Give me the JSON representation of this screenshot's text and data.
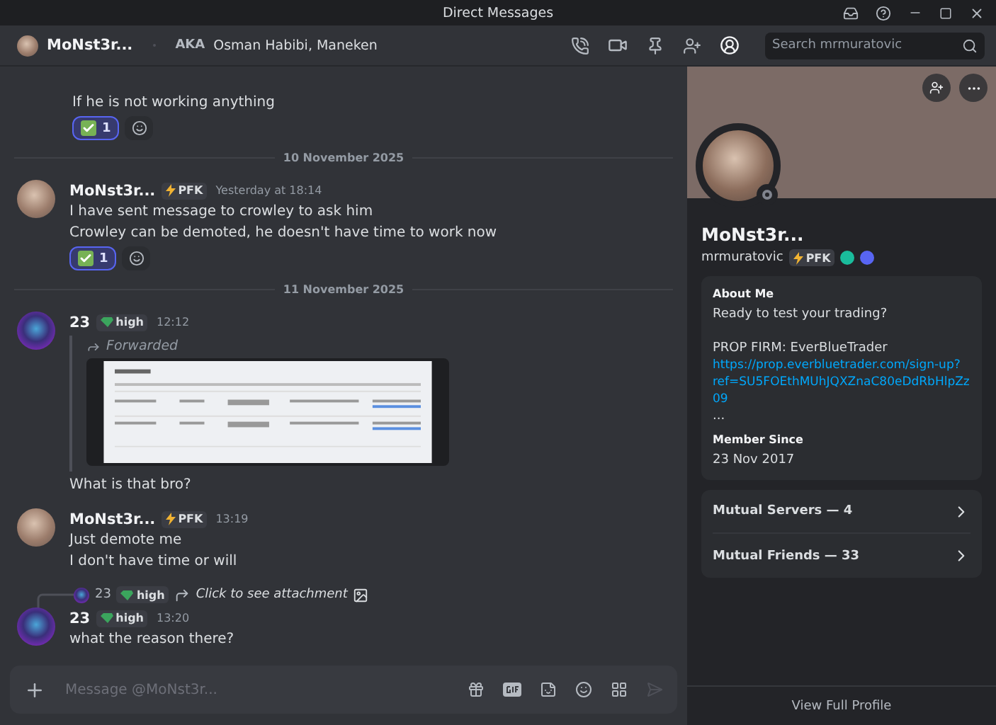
{
  "window": {
    "title": "Direct Messages"
  },
  "header": {
    "name": "MoNst3r...",
    "aka_label": "AKA",
    "aka_names": "Osman Habibi, Maneken",
    "search": {
      "placeholder": "Search mrmuratovic"
    }
  },
  "feed": [
    {
      "kind": "tail",
      "lines": [
        "If he is not working anything"
      ],
      "reactions": [
        {
          "count": "1",
          "selected": true
        }
      ]
    },
    {
      "kind": "divider",
      "label": "10 November 2025"
    },
    {
      "kind": "message",
      "author": "MoNst3r...",
      "tag": {
        "kind": "bolt",
        "label": "PFK"
      },
      "time": "Yesterday at 18:14",
      "lines": [
        "I have sent message to crowley to ask him",
        "Crowley can be demoted, he doesn't have time to work now"
      ],
      "reactions": [
        {
          "count": "1",
          "selected": true
        }
      ]
    },
    {
      "kind": "divider",
      "label": "11 November 2025"
    },
    {
      "kind": "message",
      "author": "23",
      "tag": {
        "kind": "gem",
        "label": "high"
      },
      "time": "12:12",
      "forward": {
        "label": "Forwarded"
      },
      "lines": [
        "What is that bro?"
      ]
    },
    {
      "kind": "message",
      "author": "MoNst3r...",
      "tag": {
        "kind": "bolt",
        "label": "PFK"
      },
      "time": "13:19",
      "lines": [
        "Just demote me",
        "I don't have time or will"
      ]
    },
    {
      "kind": "message",
      "author": "23",
      "tag": {
        "kind": "gem",
        "label": "high"
      },
      "time": "13:20",
      "reply": {
        "author": "23",
        "tag": {
          "kind": "gem",
          "label": "high"
        },
        "text": "Click to see attachment"
      },
      "lines": [
        "what the reason there?"
      ]
    }
  ],
  "composer": {
    "placeholder": "Message @MoNst3r..."
  },
  "profile": {
    "name": "MoNst3r...",
    "username": "mrmuratovic",
    "tag": {
      "kind": "bolt",
      "label": "PFK"
    },
    "about": {
      "title": "About Me",
      "lines": [
        "Ready to test your trading?",
        "PROP FIRM:  EverBlueTrader"
      ],
      "link": "https://prop.everbluetrader.com/sign-up?ref=SU5FOEthMUhJQXZnaC80eDdRbHlpZz09",
      "more": "..."
    },
    "member_since": {
      "title": "Member Since",
      "date": "23 Nov 2017"
    },
    "mutuals": [
      "Mutual Servers — 4",
      "Mutual Friends — 33"
    ],
    "footer": "View Full Profile"
  }
}
